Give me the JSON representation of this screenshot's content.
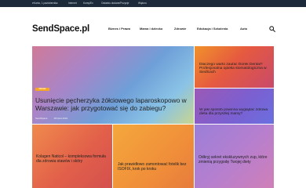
{
  "topbar": {
    "links": [
      "eKonto, 1 października",
      "Internet",
      "Kursy/Ex",
      "Ostatnio dodane/Pozycje",
      "Więtrzu"
    ]
  },
  "header": {
    "logo": "SendSpace.pl",
    "nav": [
      "Biznes i Prawo",
      "Mama i dziecko",
      "Zdrowie",
      "Edukacja i Szkolenia",
      "Auto"
    ],
    "search_icon": "search-icon"
  },
  "featured": {
    "category": "Zdrowie",
    "title": "Usunięcie pęcherzyka żółciowego laparoskopowo w Warszawie: jak przygotować się do zabiegu?",
    "author": "SendSpace",
    "date": "18 lipca 2022"
  },
  "side_tiles": [
    {
      "title": "Dlaczego warto zaufać Dorek Dental? Profesjonalna opieka stomatologiczna w Siedlcach"
    },
    {
      "title": "W jaki sposób powinna wyglądać zdrowa dieta dla przyszłej mamy?"
    }
  ],
  "bottom_tiles": [
    {
      "title": "Kolagen Naticol – kompleksowa formuła dla zdrowia stawów i skóry"
    },
    {
      "title": "Jak prawidłowo zamontować fotelik bez ISOFIX, krok po kroku"
    },
    {
      "title": "Odkryj sekret ekskluzywnych zup, które zmienią przygodę Twojej diety"
    }
  ],
  "colors": {
    "topbar": "#1c2a3a",
    "badge": "#f5a623",
    "text_on_tile": "#ffffff"
  }
}
